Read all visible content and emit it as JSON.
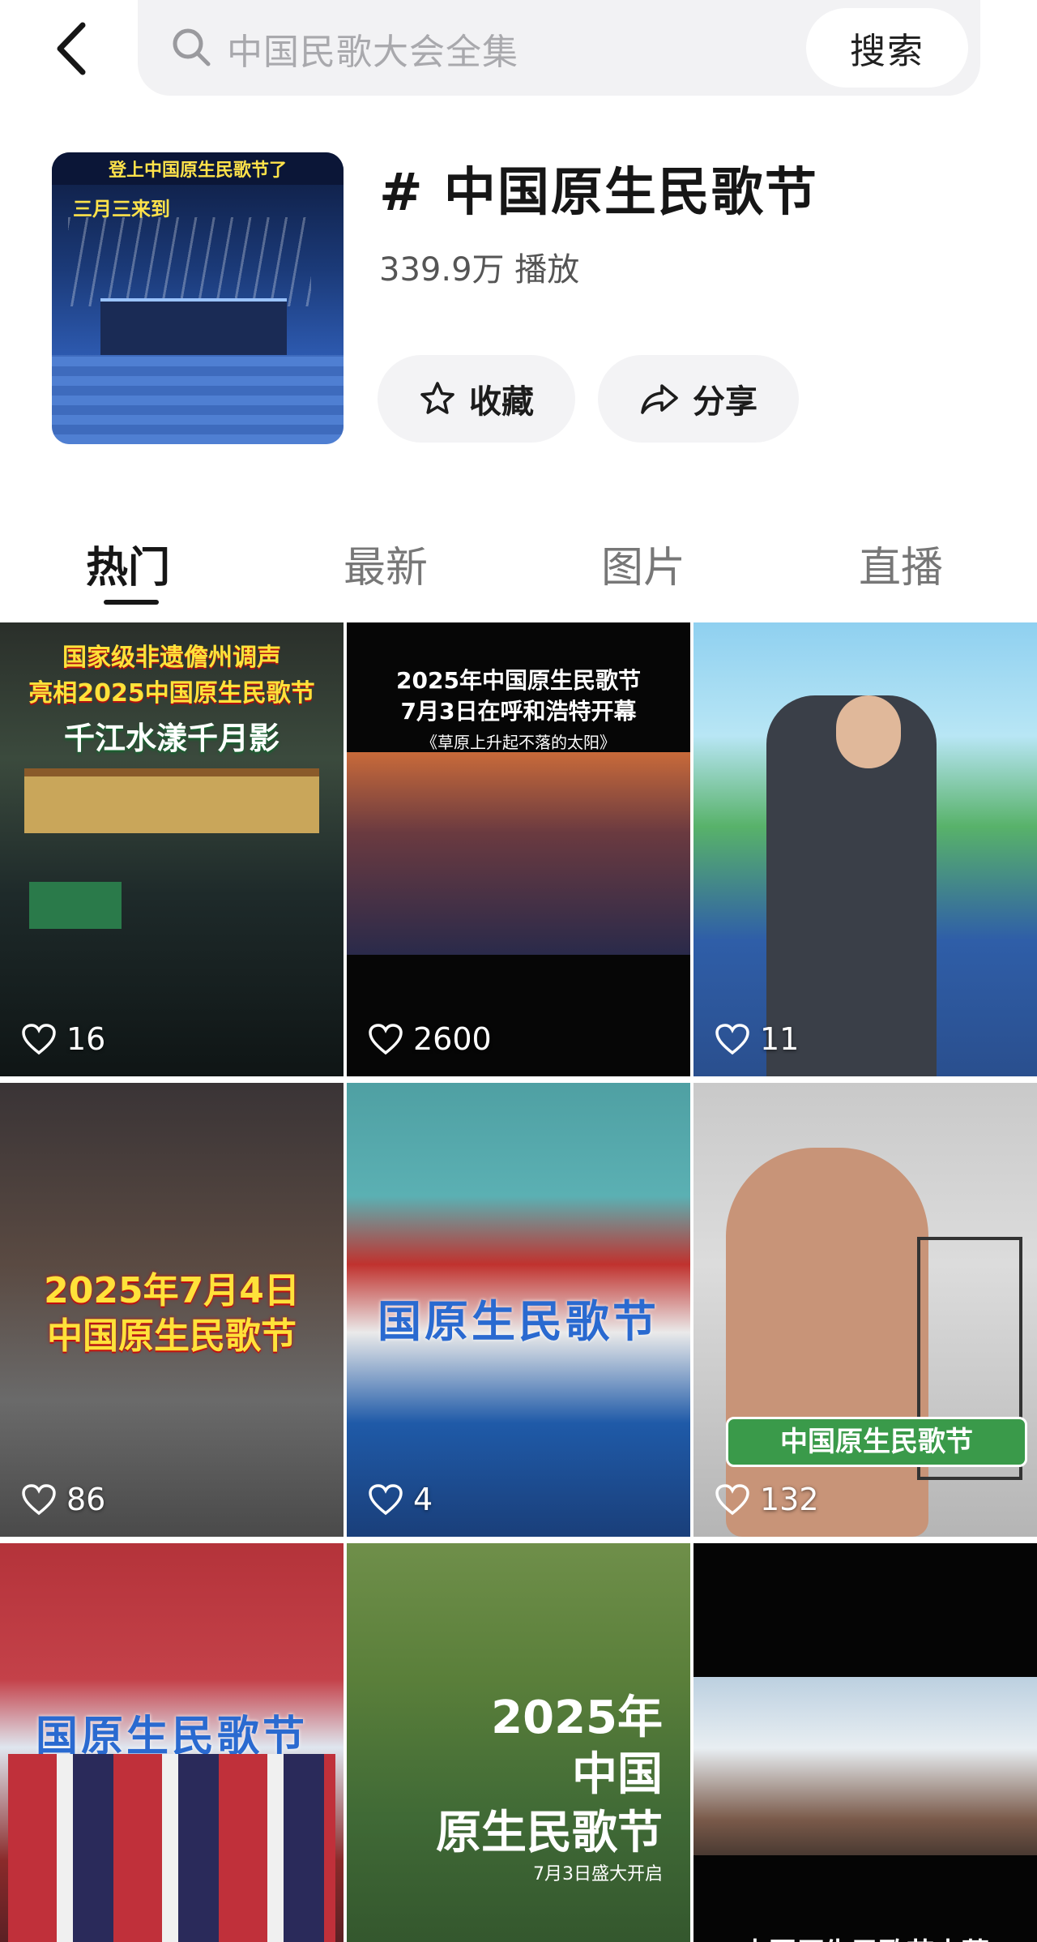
{
  "search": {
    "placeholder": "中国民歌大会全集",
    "button_label": "搜索"
  },
  "topic": {
    "cover_banner": "登上中国原生民歌节了",
    "cover_subtitle": "三月三来到",
    "title": "# 中国原生民歌节",
    "plays": "339.9万 播放",
    "favorite_label": "收藏",
    "share_label": "分享"
  },
  "tabs": [
    "热门",
    "最新",
    "图片",
    "直播"
  ],
  "active_tab": "热门",
  "videos": [
    {
      "title_1": "国家级非遗儋州调声",
      "title_2": "亮相2025中国原生民歌节",
      "title_3": "千江水漾千月影",
      "likes": "16"
    },
    {
      "title_1": "2025年中国原生民歌节",
      "title_2": "7月3日在呼和浩特开幕",
      "title_3": "《草原上升起不落的太阳》",
      "likes": "2600"
    },
    {
      "likes": "11"
    },
    {
      "title_1": "2025年7月4日",
      "title_2": "中国原生民歌节",
      "likes": "86"
    },
    {
      "title_1": "国原生民歌节",
      "likes": "4"
    },
    {
      "title_1": "中国原生民歌节",
      "likes": "132"
    },
    {
      "title_1": "国原生民歌节"
    },
    {
      "title_1": "2025年",
      "title_2": "中国",
      "title_3": "原生民歌节",
      "title_4": "7月3日盛大开启"
    },
    {
      "title_1": "中国原生民歌节内蒙"
    }
  ],
  "colors": {
    "accent_text": "#161616",
    "muted_text": "#777777",
    "search_bg": "#f2f2f4",
    "button_bg": "#f3f3f5"
  }
}
